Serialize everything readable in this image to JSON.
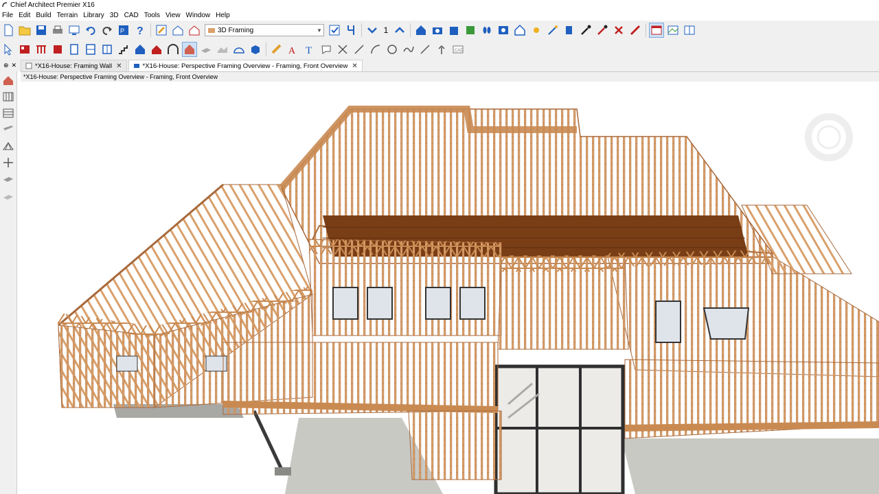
{
  "window": {
    "title": "Chief Architect Premier X16"
  },
  "menu": [
    "File",
    "Edit",
    "Build",
    "Terrain",
    "Library",
    "3D",
    "CAD",
    "Tools",
    "View",
    "Window",
    "Help"
  ],
  "toolbar": {
    "view_select": "3D Framing",
    "floor_number": "1"
  },
  "tabs": [
    {
      "label": "*X16-House: Framing Wall",
      "close": "✕",
      "active": false
    },
    {
      "label": "*X16-House: Perspective Framing Overview - Framing, Front Overview",
      "close": "✕",
      "active": true
    }
  ],
  "pin_controls": {
    "pin": "⊕",
    "close": "✕"
  },
  "document_path": "*X16-House: Perspective Framing Overview - Framing, Front Overview",
  "colors": {
    "lumber": "#d9a06b",
    "lumber_dark": "#a8693b",
    "subfloor": "#7a3e16",
    "concrete": "#c9c9c4",
    "steel": "#3a3a3a",
    "accent": "#1f5fbf"
  }
}
